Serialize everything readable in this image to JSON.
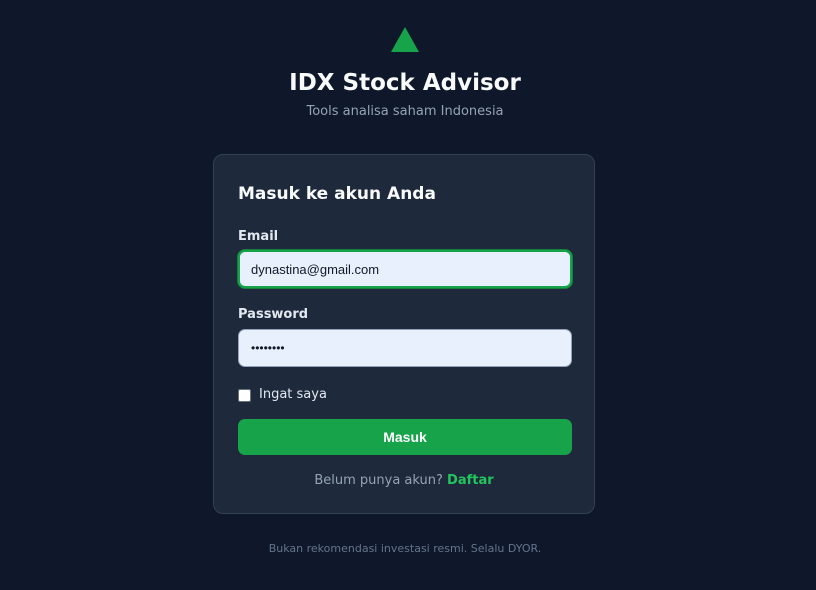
{
  "app": {
    "title": "IDX Stock Advisor",
    "subtitle": "Tools analisa saham Indonesia",
    "logo_icon": "triangle-up-icon"
  },
  "login": {
    "heading": "Masuk ke akun Anda",
    "email_label": "Email",
    "email_value": "dynastina@gmail.com",
    "password_label": "Password",
    "password_value": "••••••••",
    "remember_label": "Ingat saya",
    "remember_checked": false,
    "submit_label": "Masuk",
    "register_prompt": "Belum punya akun?",
    "register_link": "Daftar"
  },
  "footer": {
    "disclaimer": "Bukan rekomendasi investasi resmi. Selalu DYOR."
  },
  "colors": {
    "background": "#0f172a",
    "card": "#1e293b",
    "accent": "#16a34a",
    "link": "#22c55e"
  }
}
